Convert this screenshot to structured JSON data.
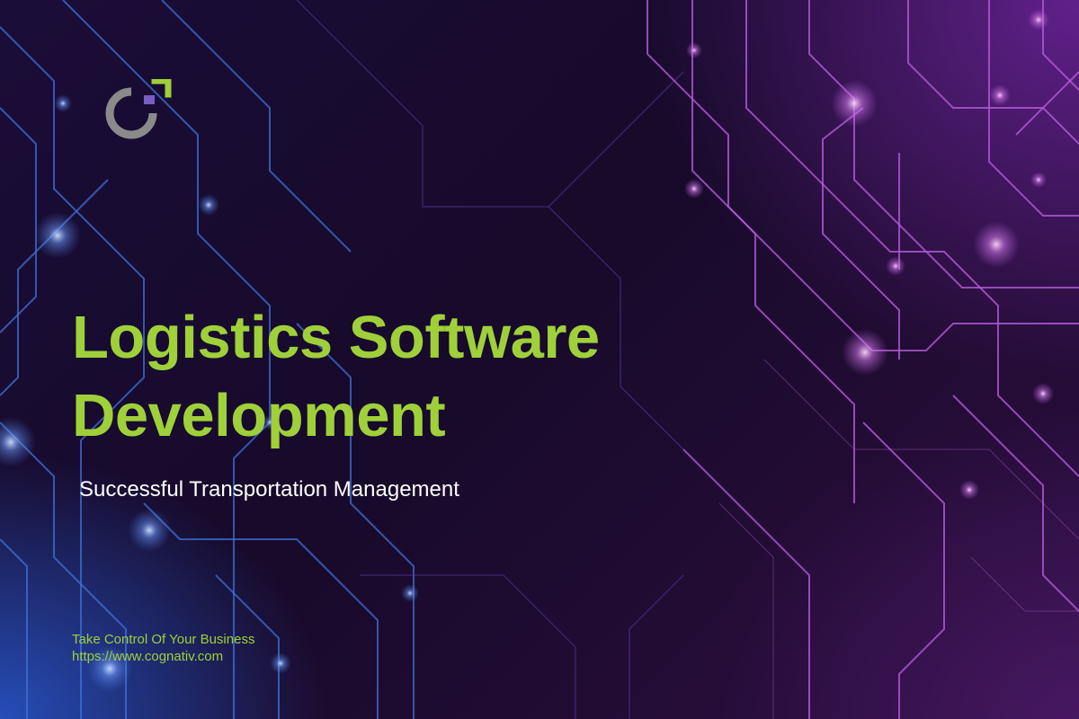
{
  "slide": {
    "headline_line1": "Logistics Software",
    "headline_line2": "Development",
    "subtitle": "Successful Transportation Management",
    "tagline": "Take Control Of Your Business",
    "url": "https://www.cognativ.com"
  },
  "logo": {
    "icon": "cognativ-logo-icon",
    "ring_color": "#8a8a8a",
    "corner_color": "#9fd03a",
    "accent_color": "#7a5cc4"
  },
  "colors": {
    "accent": "#9fd03a",
    "text": "#ffffff",
    "background_dark": "#170a2a",
    "circuit_blue": "#3f72d8",
    "circuit_purple": "#b35ad8"
  }
}
